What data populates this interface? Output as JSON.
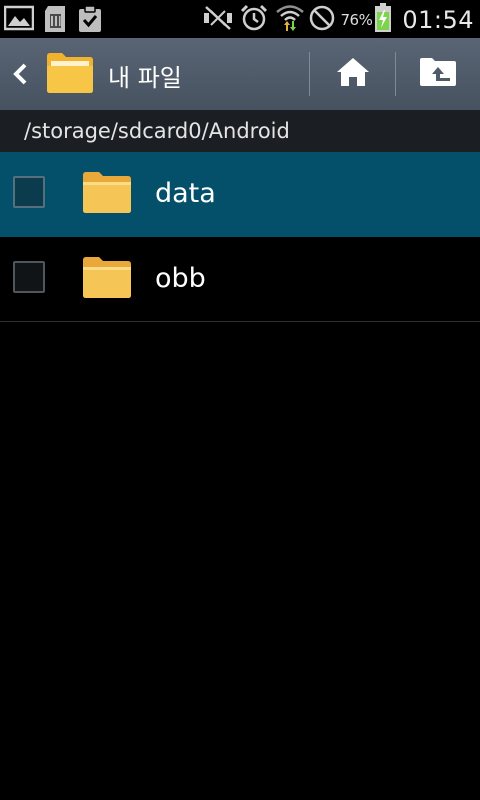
{
  "status_bar": {
    "battery_percent": "76%",
    "time": "01:54",
    "icons": [
      "gallery-icon",
      "sd-card-icon",
      "clipboard-check-icon",
      "mute-icon",
      "alarm-icon",
      "wifi-icon",
      "no-signal-icon",
      "battery-charging-icon"
    ]
  },
  "action_bar": {
    "title": "내 파일",
    "home_icon": "home-icon",
    "up_icon": "folder-up-icon"
  },
  "path": "/storage/sdcard0/Android",
  "files": [
    {
      "name": "data",
      "selected": true
    },
    {
      "name": "obb",
      "selected": false
    }
  ],
  "colors": {
    "action_bar": "#4f5b69",
    "selected_row": "#04506a",
    "folder": "#f3c34e",
    "battery": "#7bd44a",
    "path_bar": "#1b1e22"
  }
}
